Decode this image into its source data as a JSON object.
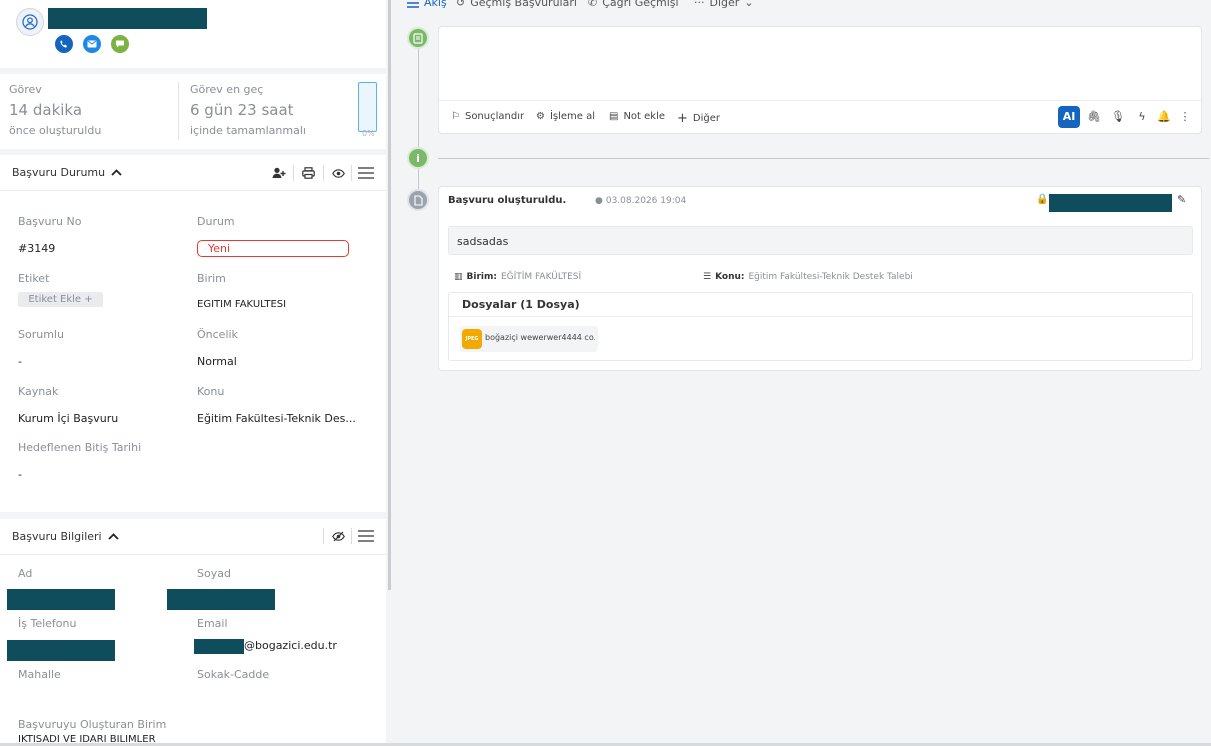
{
  "profile": {
    "contact_icons": [
      "phone-icon",
      "mail-icon",
      "chat-icon"
    ]
  },
  "stats": {
    "created_label": "Görev",
    "created_value": "14 dakika",
    "created_sub": "önce oluşturuldu",
    "due_label": "Görev en geç",
    "due_value": "6 gün 23 saat",
    "due_sub": "içinde tamamlanmalı",
    "progress_label": "0%",
    "progress_value": 0
  },
  "status_section": {
    "title": "Başvuru Durumu",
    "fields": {
      "no_label": "Başvuru No",
      "no_value": "#3149",
      "status_label": "Durum",
      "status_value": "Yeni",
      "tag_label": "Etiket",
      "tag_button": "Etiket Ekle +",
      "unit_label": "Birim",
      "unit_value": "EĞİTİM FAKÜLTESİ",
      "owner_label": "Sorumlu",
      "owner_value": "-",
      "priority_label": "Öncelik",
      "priority_value": "Normal",
      "source_label": "Kaynak",
      "source_value": "Kurum İçi Başvuru",
      "subject_label": "Konu",
      "subject_value": "Eğitim Fakültesi-Teknik Des...",
      "target_label": "Hedeflenen Bitiş Tarihi",
      "target_value": "-"
    }
  },
  "info_section": {
    "title": "Başvuru Bilgileri",
    "fields": {
      "name_label": "Ad",
      "surname_label": "Soyad",
      "phone_label": "İş Telefonu",
      "email_label": "Email",
      "email_suffix": "@bogazici.edu.tr",
      "district_label": "Mahalle",
      "street_label": "Sokak-Cadde",
      "creator_unit_label": "Başvuruyu Oluşturan Birim",
      "creator_unit_value": "İKTİSADİ VE İDARİ BİLİMLER"
    }
  },
  "tabs": [
    "Akış",
    "Geçmiş Başvuruları",
    "Çağrı Geçmişi",
    "Diğer"
  ],
  "composer": {
    "actions": [
      "Sonuçlandır",
      "İşleme al",
      "Not ekle",
      "Diğer"
    ],
    "ai_label": "AI"
  },
  "event": {
    "title": "Başvuru oluşturuldu.",
    "timestamp": "03.08.2026 19:04",
    "message": "sadsadas",
    "unit_label": "Birim:",
    "unit_value": "EĞİTİM FAKÜLTESİ",
    "subject_label": "Konu:",
    "subject_value": "Eğitim Fakültesi-Teknik Destek Talebi",
    "files_title": "Dosyalar (1 Dosya)",
    "file_badge": "JPEG",
    "file_name": "boğaziçi wewerwer4444 co..."
  },
  "colors": {
    "accent": "#1565c0",
    "green": "#7cb86a",
    "redact": "#0f4c5c",
    "status_red": "#e53935"
  }
}
